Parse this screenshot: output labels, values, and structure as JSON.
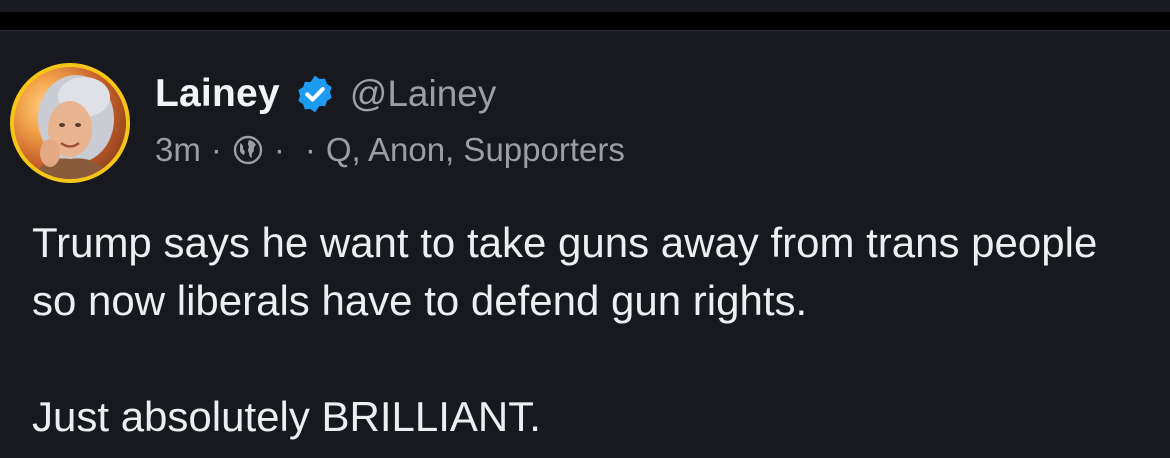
{
  "post": {
    "author": {
      "display_name": "Lainey",
      "handle": "@Lainey",
      "verified": true,
      "verified_color": "#1d9bf0",
      "avatar_ring_color": "#f5c518"
    },
    "meta": {
      "time": "3m",
      "separator": "·",
      "visibility_icon": "globe-icon",
      "audience": "Q, Anon, Supporters"
    },
    "text": {
      "paragraph_1": "Trump says he want to take guns away from trans people so now liberals have to defend gun rights.",
      "paragraph_2": "Just absolutely BRILLIANT."
    }
  },
  "colors": {
    "background": "#17191e",
    "text_primary": "#eceef1",
    "text_secondary": "#9a9ea6"
  }
}
